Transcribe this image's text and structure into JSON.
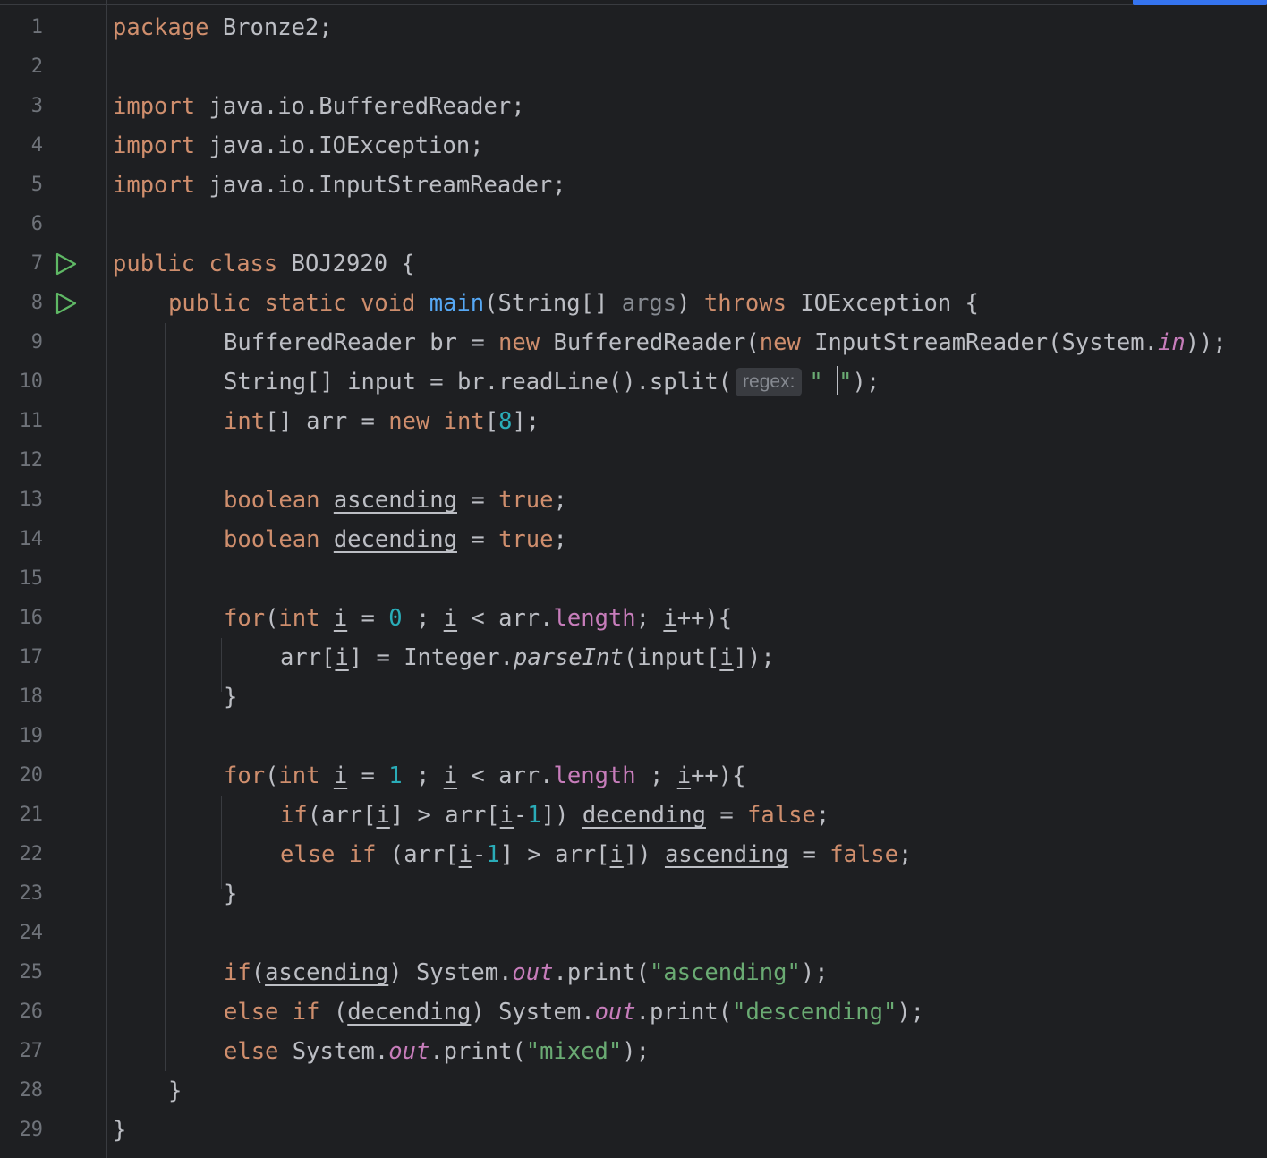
{
  "editor": {
    "line_numbers": [
      "1",
      "2",
      "3",
      "4",
      "5",
      "6",
      "7",
      "8",
      "9",
      "10",
      "11",
      "12",
      "13",
      "14",
      "15",
      "16",
      "17",
      "18",
      "19",
      "20",
      "21",
      "22",
      "23",
      "24",
      "25",
      "26",
      "27",
      "28",
      "29"
    ],
    "run_icon": "run-triangle-icon",
    "hint_regex": "regex:",
    "code": {
      "l1": [
        "package",
        " Bronze2;"
      ],
      "l3": [
        "import",
        " java.io.BufferedReader;"
      ],
      "l4": [
        "import",
        " java.io.IOException;"
      ],
      "l5": [
        "import",
        " java.io.InputStreamReader;"
      ],
      "l7": [
        "public",
        " ",
        "class",
        " BOJ2920 {"
      ],
      "l8": [
        "public",
        " ",
        "static",
        " ",
        "void",
        " ",
        "main",
        "(String[] ",
        "args",
        ") ",
        "throws",
        " IOException {"
      ],
      "l9": [
        "BufferedReader br = ",
        "new",
        " BufferedReader(",
        "new",
        " InputStreamReader(System.",
        "in",
        "));"
      ],
      "l10": [
        "String[] input = br.readLine().split(",
        "\" ",
        "\"",
        ");"
      ],
      "l11": [
        "int",
        "[] arr = ",
        "new",
        " ",
        "int",
        "[",
        "8",
        "];"
      ],
      "l13": [
        "boolean",
        " ",
        "ascending",
        " = ",
        "true",
        ";"
      ],
      "l14": [
        "boolean",
        " ",
        "decending",
        " = ",
        "true",
        ";"
      ],
      "l16": [
        "for",
        "(",
        "int",
        " ",
        "i",
        " = ",
        "0",
        " ; ",
        "i",
        " < arr.",
        "length",
        "; ",
        "i",
        "++){"
      ],
      "l17": [
        "arr[",
        "i",
        "] = Integer.",
        "parseInt",
        "(input[",
        "i",
        "]);"
      ],
      "l18": [
        "}"
      ],
      "l20": [
        "for",
        "(",
        "int",
        " ",
        "i",
        " = ",
        "1",
        " ; ",
        "i",
        " < arr.",
        "length",
        " ; ",
        "i",
        "++){"
      ],
      "l21": [
        "if",
        "(arr[",
        "i",
        "] > arr[",
        "i",
        "-",
        "1",
        "]) ",
        "decending",
        " = ",
        "false",
        ";"
      ],
      "l22": [
        "else",
        " ",
        "if",
        " (arr[",
        "i",
        "-",
        "1",
        "] > arr[",
        "i",
        "]) ",
        "ascending",
        " = ",
        "false",
        ";"
      ],
      "l23": [
        "}"
      ],
      "l25": [
        "if",
        "(",
        "ascending",
        ") System.",
        "out",
        ".print(",
        "\"ascending\"",
        ");"
      ],
      "l26": [
        "else",
        " ",
        "if",
        " (",
        "decending",
        ") System.",
        "out",
        ".print(",
        "\"descending\"",
        ");"
      ],
      "l27": [
        "else",
        " System.",
        "out",
        ".print(",
        "\"mixed\"",
        ");"
      ],
      "l28": [
        "}"
      ],
      "l29": [
        "}"
      ]
    }
  },
  "colors": {
    "background": "#1e1f22",
    "keyword": "#cf8e6d",
    "number": "#2aacb8",
    "string": "#6aab73",
    "method": "#56a8f5",
    "field": "#c77dbb",
    "text": "#bcbec4",
    "line_number": "#6f737a",
    "run_icon": "#5fb865",
    "scroll_thumb": "#3574f0"
  }
}
